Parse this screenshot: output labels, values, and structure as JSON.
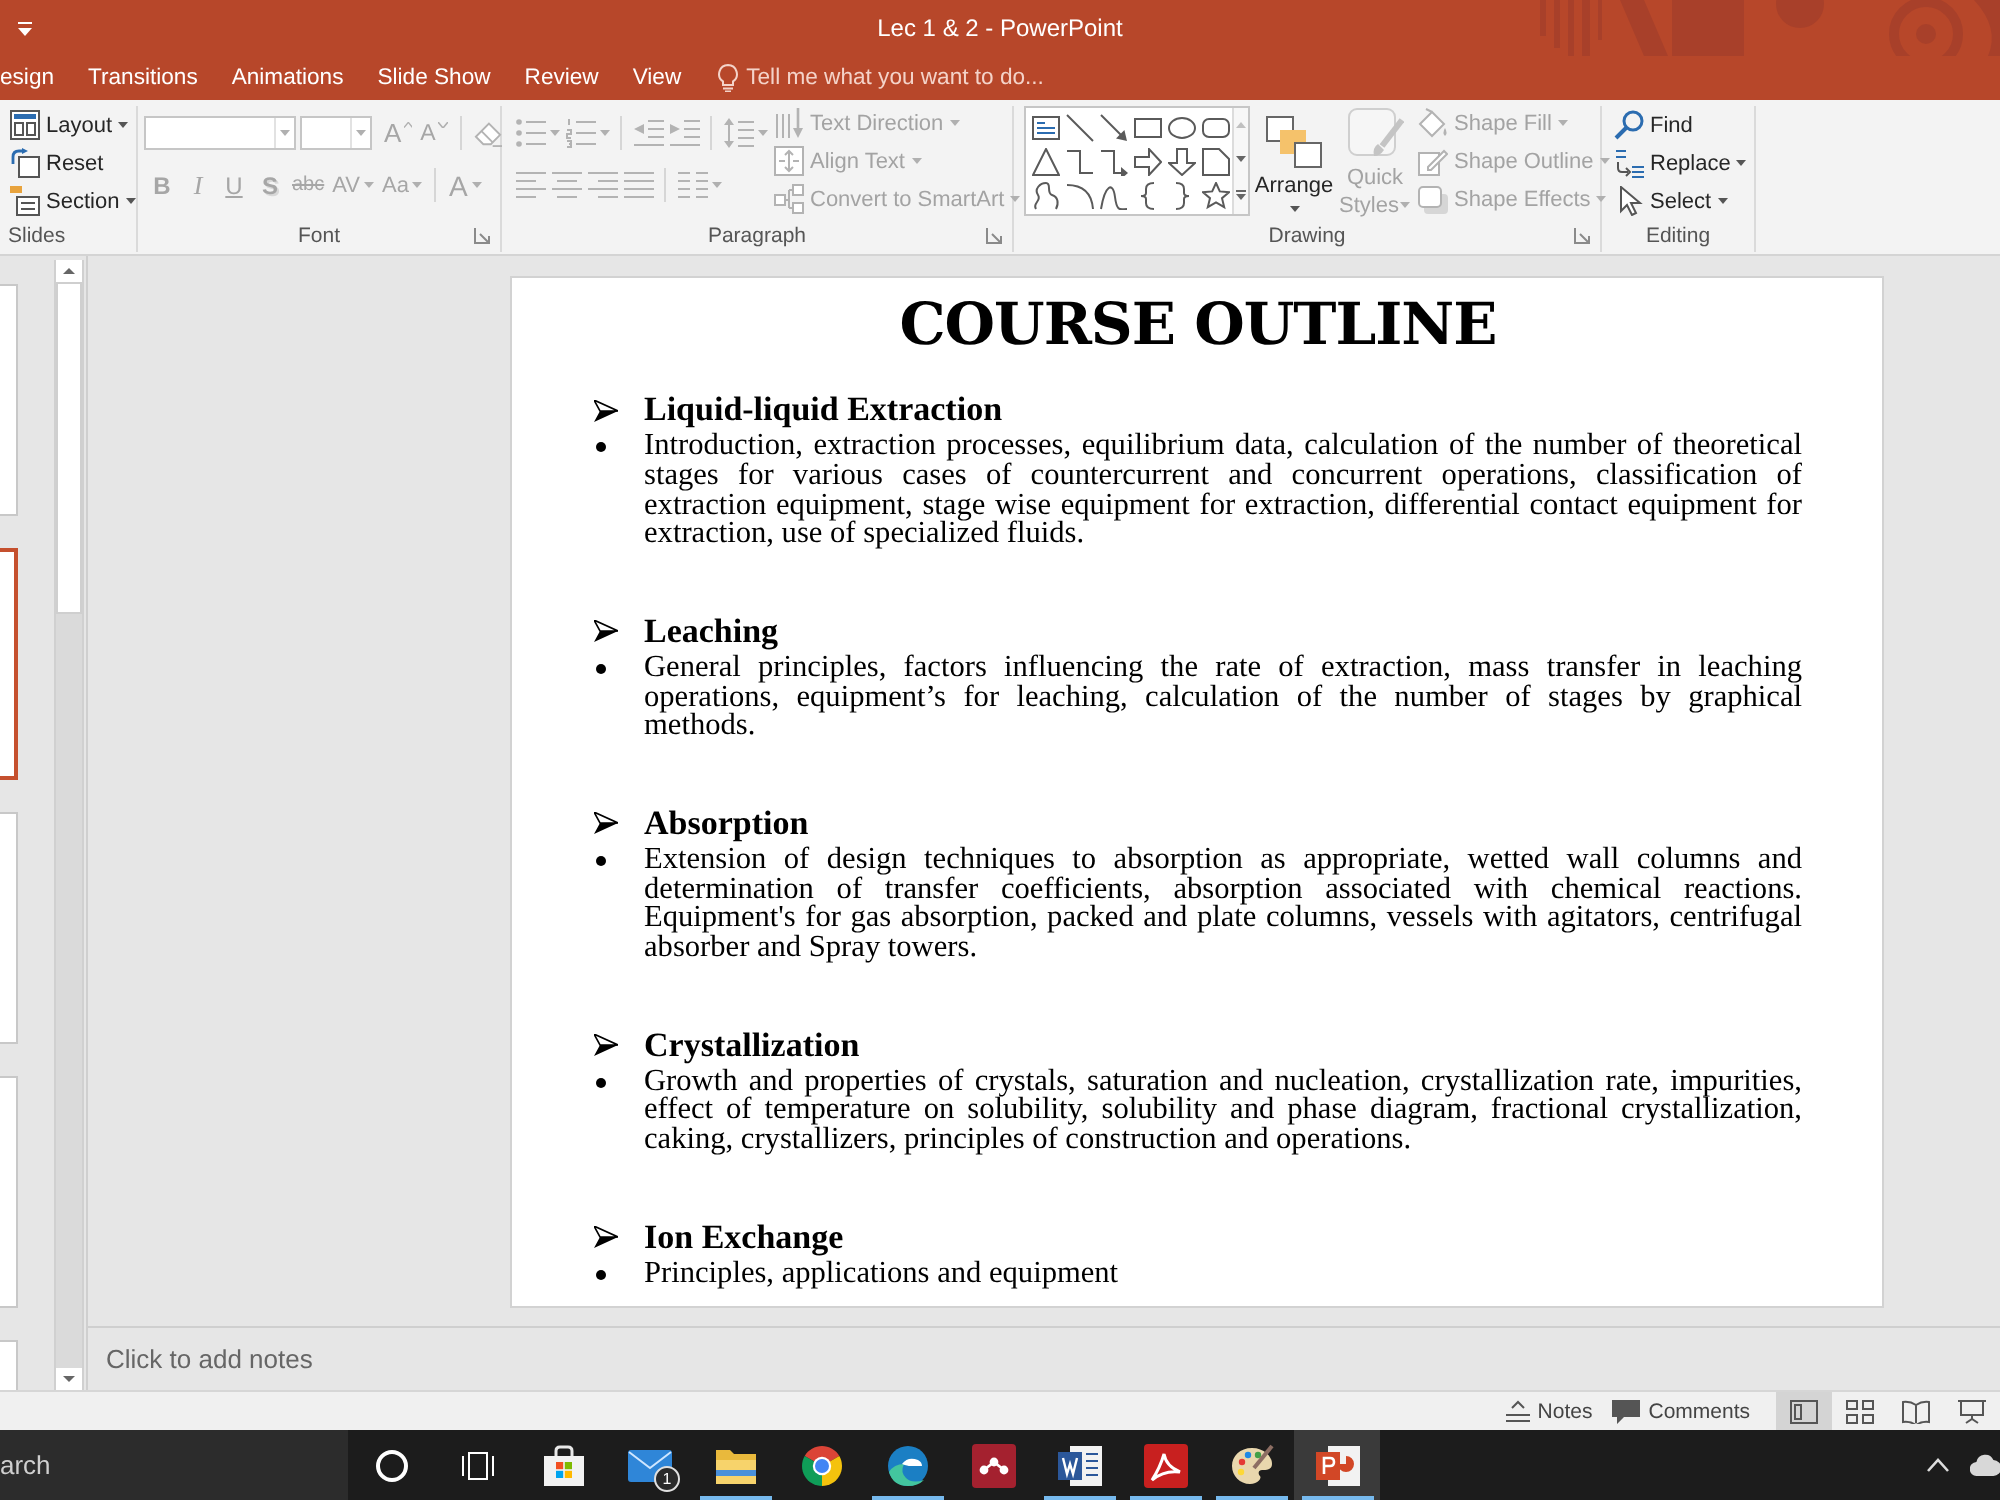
{
  "window": {
    "title": "Lec 1 & 2 - PowerPoint"
  },
  "ribbon_tabs": [
    {
      "label": "esign",
      "selected": false
    },
    {
      "label": "Transitions",
      "selected": false
    },
    {
      "label": "Animations",
      "selected": false
    },
    {
      "label": "Slide Show",
      "selected": false
    },
    {
      "label": "Review",
      "selected": false
    },
    {
      "label": "View",
      "selected": false
    }
  ],
  "tell_me": {
    "placeholder": "Tell me what you want to do..."
  },
  "ribbon": {
    "slides": {
      "label": "Slides",
      "launcher": false,
      "commands": [
        {
          "kind": "layout",
          "label": "Layout",
          "dropdown": true,
          "disabled": false
        },
        {
          "kind": "reset",
          "label": "Reset",
          "dropdown": false,
          "disabled": false
        },
        {
          "kind": "section",
          "label": "Section",
          "dropdown": true,
          "disabled": false
        }
      ]
    },
    "font": {
      "label": "Font",
      "launcher": true,
      "top_buttons": [
        {
          "kind": "grow",
          "label": "A",
          "dropdown": false,
          "disabled": true
        },
        {
          "kind": "shrink",
          "label": "A",
          "dropdown": false,
          "disabled": true
        },
        {
          "kind": "clear",
          "dropdown": false,
          "disabled": true
        }
      ],
      "bottom_buttons": [
        {
          "kind": "bold",
          "label": "B",
          "dropdown": false,
          "disabled": true
        },
        {
          "kind": "italic",
          "label": "I",
          "dropdown": false,
          "disabled": true
        },
        {
          "kind": "underline",
          "label": "U",
          "dropdown": false,
          "disabled": true
        },
        {
          "kind": "shadow",
          "label": "S",
          "dropdown": false,
          "disabled": true
        },
        {
          "kind": "strike",
          "label": "abc",
          "dropdown": false,
          "disabled": true
        },
        {
          "kind": "spacing",
          "label": "AV",
          "dropdown": true,
          "disabled": true
        },
        {
          "kind": "case",
          "label": "Aa",
          "dropdown": true,
          "disabled": true
        },
        {
          "kind": "color",
          "label": "A",
          "dropdown": true,
          "disabled": true
        }
      ]
    },
    "paragraph": {
      "label": "Paragraph",
      "launcher": true,
      "top_buttons": [
        {
          "kind": "bullets",
          "dropdown": true,
          "disabled": true
        },
        {
          "kind": "numbering",
          "dropdown": true,
          "disabled": true
        },
        {
          "kind": "indent-less",
          "dropdown": false,
          "disabled": true
        },
        {
          "kind": "indent-more",
          "dropdown": false,
          "disabled": true
        },
        {
          "kind": "line-spacing",
          "dropdown": true,
          "disabled": true
        }
      ],
      "bottom_buttons": [
        {
          "kind": "align-left",
          "dropdown": false,
          "disabled": true
        },
        {
          "kind": "align-center",
          "dropdown": false,
          "disabled": true
        },
        {
          "kind": "align-right",
          "dropdown": false,
          "disabled": true
        },
        {
          "kind": "justify",
          "dropdown": false,
          "disabled": true
        },
        {
          "kind": "columns",
          "dropdown": true,
          "disabled": true
        }
      ],
      "commands": [
        {
          "kind": "text-direction",
          "label": "Text Direction",
          "dropdown": true,
          "disabled": true
        },
        {
          "kind": "align-text",
          "label": "Align Text",
          "dropdown": true,
          "disabled": true
        },
        {
          "kind": "smartart",
          "label": "Convert to SmartArt",
          "dropdown": true,
          "disabled": true
        }
      ]
    },
    "drawing": {
      "label": "Drawing",
      "launcher": true,
      "large_buttons": [
        {
          "kind": "arrange",
          "label": "Arrange",
          "dropdown": true,
          "disabled": false
        },
        {
          "kind": "quick-styles",
          "label": "Quick Styles",
          "dropdown": true,
          "disabled": true
        }
      ],
      "commands": [
        {
          "kind": "shape-fill",
          "label": "Shape Fill",
          "dropdown": true,
          "disabled": true
        },
        {
          "kind": "shape-outline",
          "label": "Shape Outline",
          "dropdown": true,
          "disabled": true
        },
        {
          "kind": "shape-effects",
          "label": "Shape Effects",
          "dropdown": true,
          "disabled": true
        }
      ]
    },
    "editing": {
      "label": "Editing",
      "launcher": false,
      "commands": [
        {
          "kind": "find",
          "label": "Find",
          "dropdown": false,
          "disabled": false
        },
        {
          "kind": "replace",
          "label": "Replace",
          "dropdown": true,
          "disabled": false
        },
        {
          "kind": "select",
          "label": "Select",
          "dropdown": true,
          "disabled": false
        }
      ]
    }
  },
  "slide_thumbnails": [
    {
      "selected": false
    },
    {
      "selected": true
    },
    {
      "selected": false
    },
    {
      "selected": false
    },
    {
      "selected": false
    }
  ],
  "slide": {
    "title": "COURSE OUTLINE",
    "sections": [
      {
        "heading": "Liquid-liquid Extraction",
        "text": "Introduction, extraction processes, equilibrium data, calculation of the number of theoretical stages for various cases of countercurrent and concurrent operations, classification of extraction equipment, stage wise equipment for extraction, differential contact equipment for extraction, use of specialized fluids."
      },
      {
        "heading": "Leaching",
        "text": "General principles, factors influencing the rate of extraction, mass transfer in leaching operations, equipment’s for leaching, calculation of the number of stages by graphical methods."
      },
      {
        "heading": "Absorption",
        "text": "Extension of design techniques to absorption as appropriate, wetted wall columns and determination of transfer coefficients, absorption associated with chemical reactions. Equipment's for gas absorption, packed and plate columns, vessels with agitators, centrifugal absorber and Spray towers."
      },
      {
        "heading": "Crystallization",
        "text": "Growth and properties of crystals, saturation and nucleation, crystallization rate, impurities, effect of temperature on solubility, solubility and phase diagram, fractional crystallization, caking, crystallizers, principles of construction and operations."
      },
      {
        "heading": "Ion Exchange",
        "text": "Principles, applications and equipment"
      }
    ]
  },
  "notes": {
    "placeholder": "Click to add notes"
  },
  "status_bar": {
    "buttons": [
      {
        "kind": "notes",
        "label": "Notes"
      },
      {
        "kind": "comments",
        "label": "Comments"
      }
    ],
    "views": [
      {
        "kind": "normal",
        "selected": true
      },
      {
        "kind": "sorter",
        "selected": false
      },
      {
        "kind": "reading",
        "selected": false
      },
      {
        "kind": "slideshow",
        "selected": false
      }
    ]
  },
  "taskbar": {
    "search": {
      "placeholder": "arch"
    },
    "items": [
      {
        "kind": "search-ring",
        "running": false,
        "active": false
      },
      {
        "kind": "task-view",
        "running": false,
        "active": false
      },
      {
        "kind": "bag",
        "running": false,
        "active": false
      },
      {
        "kind": "envelope",
        "badge": "1",
        "running": false,
        "active": false
      },
      {
        "kind": "folder",
        "running": true,
        "active": false
      },
      {
        "kind": "segmented-circle",
        "running": false,
        "active": false
      },
      {
        "kind": "swirl",
        "running": true,
        "active": false
      },
      {
        "kind": "dot-tile",
        "running": false,
        "active": false
      },
      {
        "kind": "document-tile",
        "running": true,
        "active": false
      },
      {
        "kind": "pdf-tile",
        "running": true,
        "active": false
      },
      {
        "kind": "palette",
        "running": true,
        "active": false
      },
      {
        "kind": "slides-tile",
        "running": true,
        "active": true
      }
    ]
  }
}
